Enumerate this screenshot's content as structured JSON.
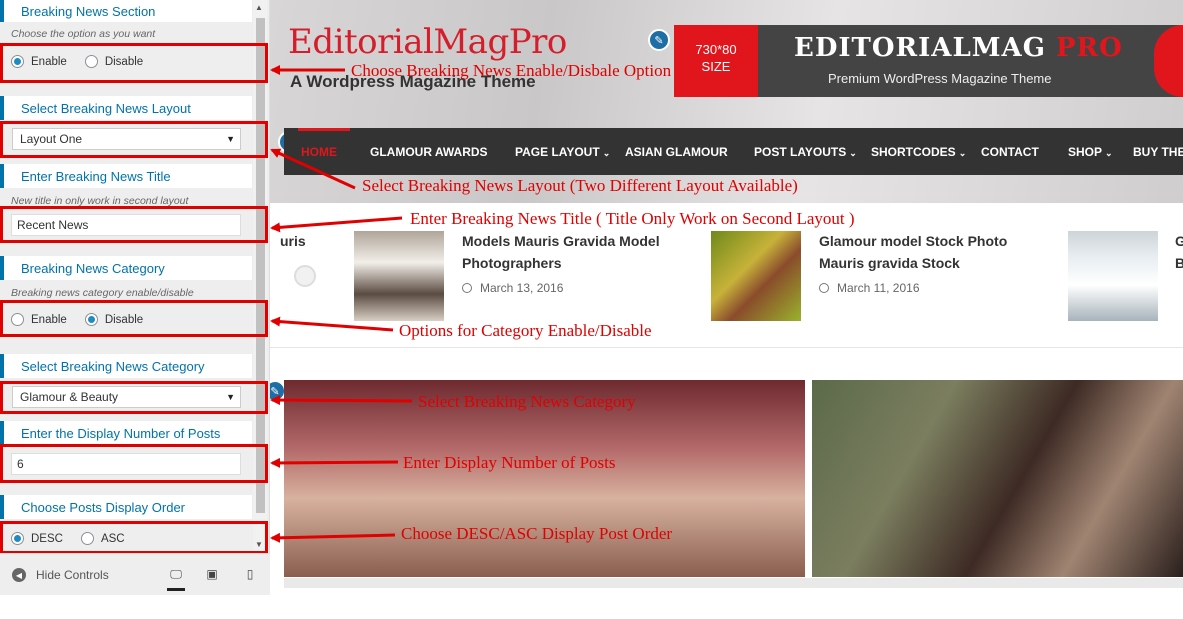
{
  "panel": {
    "sections": [
      {
        "title": "Breaking News Section",
        "desc": "Choose the option as you want",
        "options": [
          "Enable",
          "Disable"
        ],
        "selected": "Enable"
      },
      {
        "title": "Select Breaking News Layout",
        "value": "Layout One"
      },
      {
        "title": "Enter Breaking News Title",
        "desc": "New title in only work in second layout",
        "value": "Recent News"
      },
      {
        "title": "Breaking News Category",
        "desc": "Breaking news category enable/disable",
        "options": [
          "Enable",
          "Disable"
        ],
        "selected": "Disable"
      },
      {
        "title": "Select Breaking News Category",
        "value": "Glamour & Beauty"
      },
      {
        "title": "Enter the Display Number of Posts",
        "value": "6"
      },
      {
        "title": "Choose Posts Display Order",
        "options": [
          "DESC",
          "ASC"
        ],
        "selected": "DESC"
      }
    ],
    "footer": {
      "hide_label": "Hide Controls",
      "icons": [
        "desktop-icon",
        "tablet-icon",
        "mobile-icon"
      ]
    }
  },
  "site": {
    "logo": "EditorialMagPro",
    "tagline": "A Wordpress Magazine Theme",
    "ad": {
      "size_line1": "730*80",
      "size_line2": "SIZE",
      "title_main": "EDITORIALMAG ",
      "title_accent": "PRO",
      "subtitle": "Premium WordPress Magazine Theme"
    },
    "nav": [
      "HOME",
      "GLAMOUR AWARDS",
      "PAGE LAYOUT",
      "ASIAN GLAMOUR",
      "POST LAYOUTS",
      "SHORTCODES",
      "CONTACT",
      "SHOP",
      "BUY THEME"
    ],
    "ticker": {
      "partial_left": "uris",
      "items": [
        {
          "title": "Models Mauris Gravida Model Photographers",
          "date": "March 13, 2016"
        },
        {
          "title": "Glamour model Stock Photo Mauris gravida Stock",
          "date": "March 11, 2016"
        }
      ],
      "partial_right_1": "G",
      "partial_right_2": "B"
    }
  },
  "annotations": [
    "Choose Breaking News Enable/Disbale Option",
    "Select Breaking News Layout (Two Different Layout Available)",
    "Enter Breaking News Title ( Title Only Work on Second Layout )",
    "Options for Category Enable/Disable",
    "Select Breaking News Category",
    "Enter Display Number of Posts",
    "Choose DESC/ASC Display Post Order"
  ],
  "colors": {
    "accent": "#0073aa",
    "annotation": "#e00000",
    "brand_red": "#e1161c",
    "nav_bg": "#333333"
  }
}
